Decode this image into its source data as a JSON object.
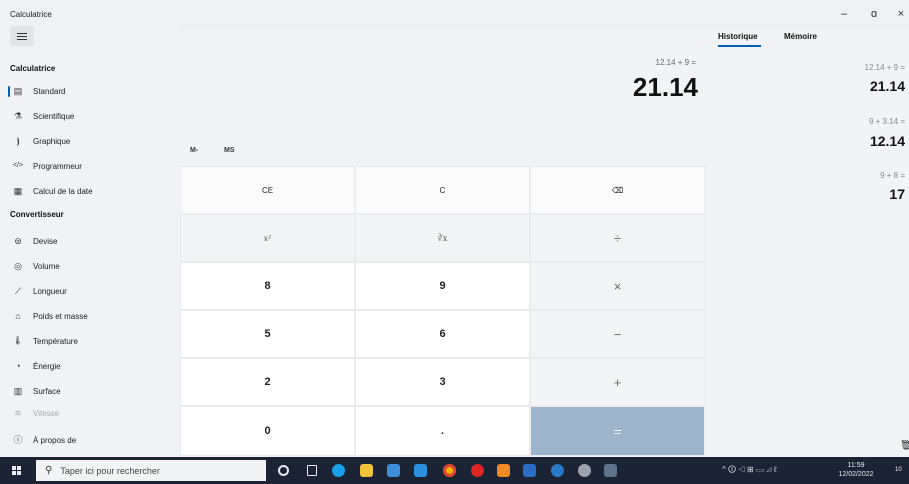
{
  "window": {
    "title": "Calculatrice",
    "controls": {
      "minimize": "–",
      "maximize": "ɑ",
      "close": "×"
    }
  },
  "nav": {
    "sections": [
      {
        "title": "Calculatrice",
        "items": [
          {
            "label": "Standard",
            "icon": "calculator-icon",
            "glyph": "▤",
            "active": true
          },
          {
            "label": "Scientifique",
            "icon": "flask-icon",
            "glyph": "⚗"
          },
          {
            "label": "Graphique",
            "icon": "graph-icon",
            "glyph": "⦘"
          },
          {
            "label": "Programmeur",
            "icon": "code-icon",
            "glyph": "</>"
          },
          {
            "label": "Calcul de la date",
            "icon": "calendar-icon",
            "glyph": "▦"
          }
        ]
      },
      {
        "title": "Convertisseur",
        "items": [
          {
            "label": "Devise",
            "icon": "currency-icon",
            "glyph": "⊜"
          },
          {
            "label": "Volume",
            "icon": "volume-icon",
            "glyph": "◎"
          },
          {
            "label": "Longueur",
            "icon": "ruler-icon",
            "glyph": "⟋"
          },
          {
            "label": "Poids et masse",
            "icon": "weight-icon",
            "glyph": "⌂"
          },
          {
            "label": "Température",
            "icon": "thermometer-icon",
            "glyph": "🌡"
          },
          {
            "label": "Énergie",
            "icon": "energy-icon",
            "glyph": "◔"
          },
          {
            "label": "Surface",
            "icon": "area-icon",
            "glyph": "▥"
          },
          {
            "label": "Vitesse",
            "icon": "speed-icon",
            "glyph": "≋"
          }
        ]
      }
    ],
    "about": {
      "label": "À propos de",
      "icon": "info-icon",
      "glyph": "ⓘ"
    }
  },
  "display": {
    "expression": "12.14 + 9 =",
    "result": "21.14"
  },
  "memory": {
    "m_minus": "M-",
    "ms": "MS"
  },
  "keypad": [
    [
      "CE",
      "C",
      "⌫"
    ],
    [
      "x²",
      "∛x",
      "÷"
    ],
    [
      "8",
      "9",
      "×"
    ],
    [
      "5",
      "6",
      "−"
    ],
    [
      "2",
      "3",
      "+"
    ],
    [
      "0",
      ".",
      "="
    ]
  ],
  "history_panel": {
    "tabs": [
      "Historique",
      "Mémoire"
    ],
    "entries": [
      {
        "expr": "12.14  +  9 =",
        "value": "21.14"
      },
      {
        "expr": "9  +  3.14 =",
        "value": "12.14"
      },
      {
        "expr": "9  +  8 =",
        "value": "17"
      }
    ]
  },
  "taskbar": {
    "search_placeholder": "Taper ici pour rechercher",
    "time": "11:59",
    "date": "12/02/2022",
    "tray_text": "^ 🛈 ◁ ⊞ ▭ ◿ ℓ",
    "notif_badge": "10",
    "colors": {
      "bar": "#1b2434",
      "accent": "#0063b1",
      "equals": "#9db4cd"
    }
  }
}
